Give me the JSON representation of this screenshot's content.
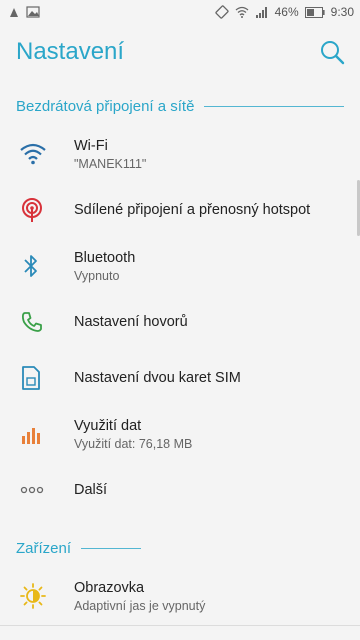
{
  "status_bar": {
    "battery": "46%",
    "time": "9:30",
    "icons": [
      "notification-icon",
      "image-icon",
      "vibrate-icon",
      "wifi-icon",
      "signal-icon",
      "battery-icon"
    ]
  },
  "app_bar": {
    "title": "Nastavení",
    "search_icon": "search-icon"
  },
  "sections": [
    {
      "header": "Bezdrátová připojení a sítě",
      "items": [
        {
          "icon": "wifi-icon",
          "primary": "Wi-Fi",
          "secondary": "\"MANEK111\""
        },
        {
          "icon": "hotspot-icon",
          "primary": "Sdílené připojení a přenosný hotspot",
          "secondary": ""
        },
        {
          "icon": "bluetooth-icon",
          "primary": "Bluetooth",
          "secondary": "Vypnuto"
        },
        {
          "icon": "phone-icon",
          "primary": "Nastavení hovorů",
          "secondary": ""
        },
        {
          "icon": "sim-card-icon",
          "primary": "Nastavení dvou karet SIM",
          "secondary": ""
        },
        {
          "icon": "data-usage-icon",
          "primary": "Využití dat",
          "secondary": "Využití dat: 76,18 MB"
        },
        {
          "icon": "more-icon",
          "primary": "Další",
          "secondary": ""
        }
      ]
    },
    {
      "header": "Zařízení",
      "items": [
        {
          "icon": "display-icon",
          "primary": "Obrazovka",
          "secondary": "Adaptivní jas je vypnutý"
        }
      ]
    }
  ],
  "colors": {
    "accent": "#2aa6c9",
    "wifi": "#2a6fa8",
    "hotspot": "#d8323a",
    "bluetooth": "#2a8ab8",
    "phone": "#3aa048",
    "sim": "#2a8ab8",
    "data": "#e8803a",
    "display": "#e8b818"
  }
}
